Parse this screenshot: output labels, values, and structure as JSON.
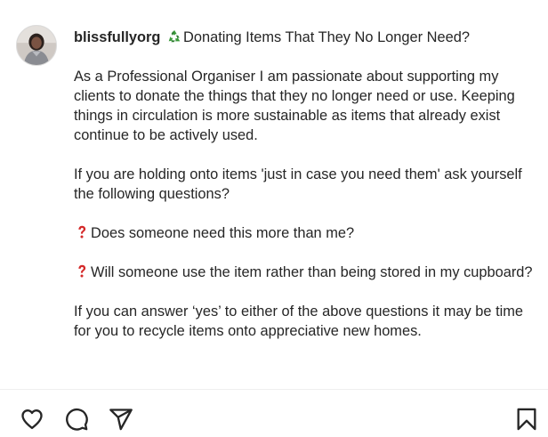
{
  "post": {
    "username": "blissfullyorg",
    "title": "Donating Items That They No Longer Need?",
    "paragraphs": [
      "As a Professional Organiser I am passionate about supporting my clients to donate the things that they no longer need or use. Keeping things in circulation is more sustainable as items that already exist continue to be actively used.",
      "If you are holding onto items 'just in case you need them' ask yourself the following questions?",
      "Does someone need this more than me?",
      "Will someone use the item rather than being stored in my cupboard?",
      "If you can answer ‘yes’ to either of the above questions it may be time for you to recycle items onto appreciative new homes."
    ]
  },
  "icons": {
    "recycle": "recycle-icon",
    "question": "red-question-mark-icon",
    "like": "heart-icon",
    "comment": "comment-icon",
    "share": "share-icon",
    "save": "bookmark-icon"
  },
  "colors": {
    "text": "#262626",
    "recycle_green": "#3a9a3a",
    "question_red": "#d42a2a",
    "divider": "#efefef"
  }
}
